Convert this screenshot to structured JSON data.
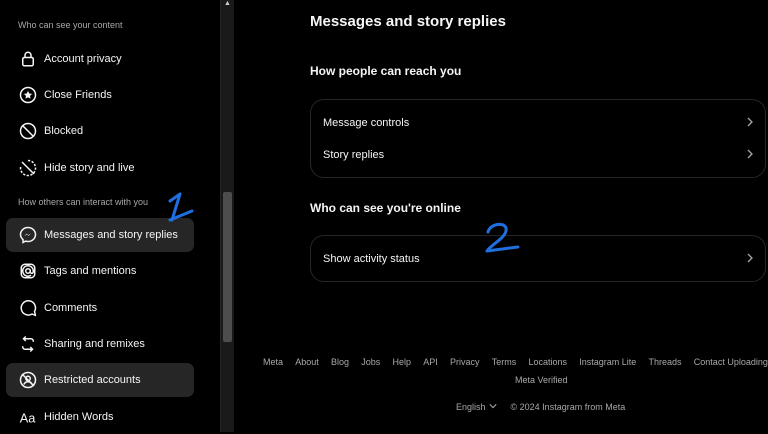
{
  "sidebar": {
    "section_who_can_see": "Who can see your content",
    "section_how_others": "How others can interact with you",
    "items": [
      {
        "label": "Account privacy",
        "icon": "lock-icon"
      },
      {
        "label": "Close Friends",
        "icon": "star-circle-icon"
      },
      {
        "label": "Blocked",
        "icon": "blocked-icon"
      },
      {
        "label": "Hide story and live",
        "icon": "hide-story-icon"
      },
      {
        "label": "Messages and story replies",
        "icon": "messenger-icon"
      },
      {
        "label": "Tags and mentions",
        "icon": "at-sign-icon"
      },
      {
        "label": "Comments",
        "icon": "comment-icon"
      },
      {
        "label": "Sharing and remixes",
        "icon": "repost-icon"
      },
      {
        "label": "Restricted accounts",
        "icon": "restricted-icon"
      },
      {
        "label": "Hidden Words",
        "icon": "hidden-words-icon"
      }
    ]
  },
  "main": {
    "title": "Messages and story replies",
    "section_reach": "How people can reach you",
    "reach_rows": [
      "Message controls",
      "Story replies"
    ],
    "section_online": "Who can see you're online",
    "online_rows": [
      "Show activity status"
    ]
  },
  "footer": {
    "links": [
      "Meta",
      "About",
      "Blog",
      "Jobs",
      "Help",
      "API",
      "Privacy",
      "Terms",
      "Locations",
      "Instagram Lite",
      "Threads",
      "Contact Uploading"
    ],
    "meta_verified": "Meta Verified",
    "language": "English",
    "copyright": "© 2024 Instagram from Meta"
  },
  "annotations": [
    "1",
    "2"
  ],
  "colors": {
    "background": "#000000",
    "active_item": "#262626",
    "annotation_blue": "#1f6fe0"
  }
}
